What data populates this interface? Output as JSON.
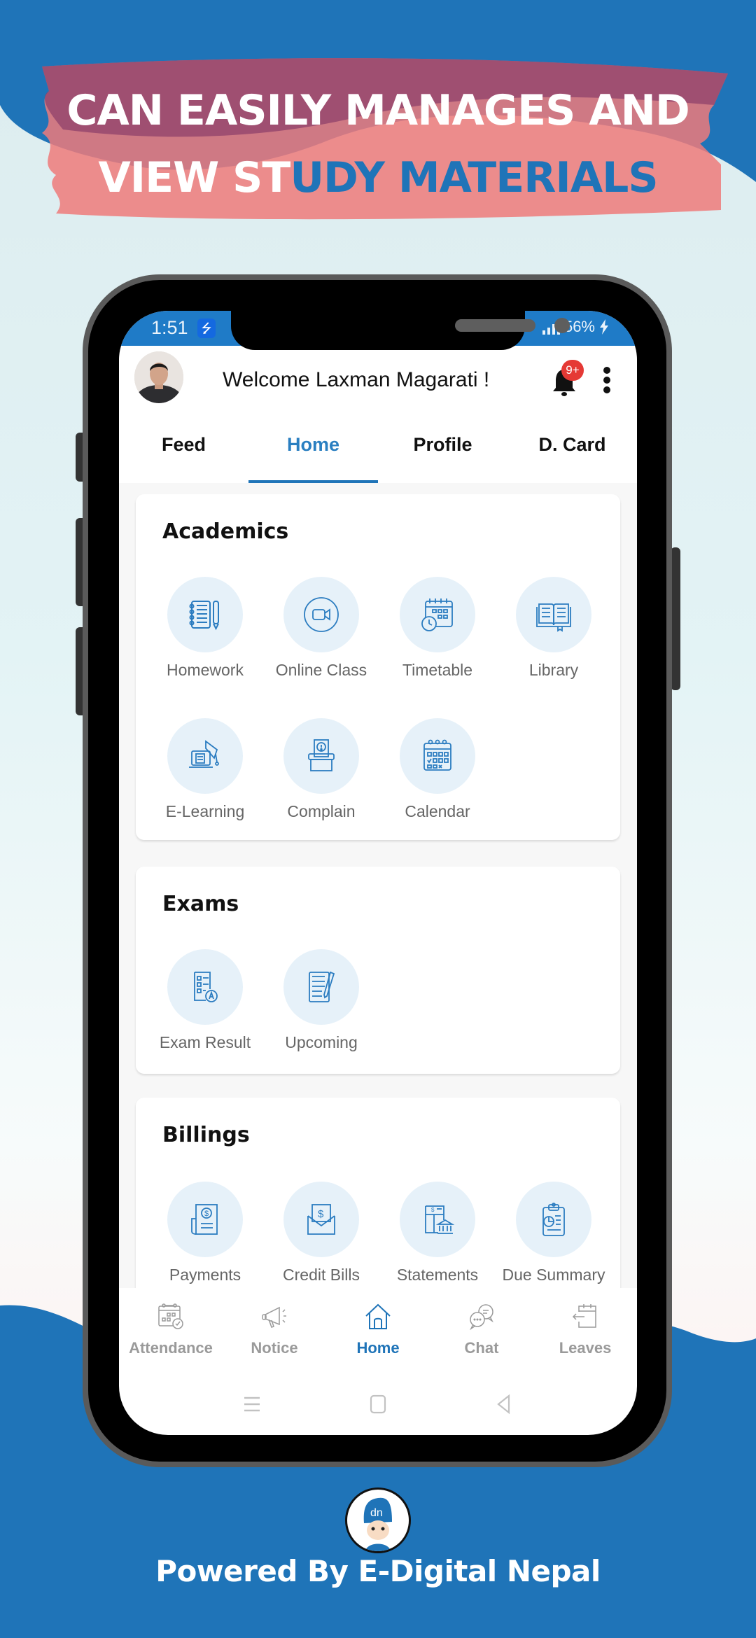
{
  "promo": {
    "headline_line1": "CAN EASILY MANAGES AND",
    "headline_line2_white": "VIEW ST",
    "headline_line2_blue": "UDY MATERIALS",
    "powered_by": "Powered By E-Digital Nepal",
    "logo_text": "dn"
  },
  "colors": {
    "brand_blue": "#1f74b8",
    "status_bar": "#1f7bc7",
    "tile_bg": "#e6f1f9",
    "badge_red": "#e53935",
    "brush_red": "#ef7a7a"
  },
  "status_bar": {
    "time": "1:51",
    "usb_icon": "usb-icon",
    "battery": "56%",
    "charging_icon": "bolt-icon"
  },
  "header": {
    "welcome": "Welcome Laxman Magarati !",
    "notification_badge": "9+"
  },
  "tabs": [
    {
      "label": "Feed",
      "active": false
    },
    {
      "label": "Home",
      "active": true
    },
    {
      "label": "Profile",
      "active": false
    },
    {
      "label": "D. Card",
      "active": false
    }
  ],
  "sections": {
    "academics": {
      "title": "Academics",
      "items": [
        {
          "label": "Homework",
          "icon": "notebook-pencil-icon"
        },
        {
          "label": "Online Class",
          "icon": "video-camera-icon"
        },
        {
          "label": "Timetable",
          "icon": "calendar-clock-icon"
        },
        {
          "label": "Library",
          "icon": "open-book-icon"
        },
        {
          "label": "E-Learning",
          "icon": "laptop-graduation-icon"
        },
        {
          "label": "Complain",
          "icon": "complaint-box-icon"
        },
        {
          "label": "Calendar",
          "icon": "calendar-icon"
        }
      ]
    },
    "exams": {
      "title": "Exams",
      "items": [
        {
          "label": "Exam Result",
          "icon": "exam-result-icon"
        },
        {
          "label": "Upcoming",
          "icon": "document-pencil-icon"
        }
      ]
    },
    "billings": {
      "title": "Billings",
      "items": [
        {
          "label": "Payments",
          "icon": "invoice-dollar-icon"
        },
        {
          "label": "Credit Bills",
          "icon": "envelope-dollar-icon"
        },
        {
          "label": "Statements",
          "icon": "bank-statement-icon"
        },
        {
          "label": "Due Summary",
          "icon": "clipboard-chart-icon"
        }
      ]
    }
  },
  "bottom_nav": [
    {
      "label": "Attendance",
      "icon": "attendance-calendar-icon",
      "active": false
    },
    {
      "label": "Notice",
      "icon": "megaphone-icon",
      "active": false
    },
    {
      "label": "Home",
      "icon": "home-icon",
      "active": true
    },
    {
      "label": "Chat",
      "icon": "chat-bubbles-icon",
      "active": false
    },
    {
      "label": "Leaves",
      "icon": "leave-calendar-icon",
      "active": false
    }
  ],
  "system_nav": [
    "recents-icon",
    "home-button-icon",
    "back-icon"
  ]
}
